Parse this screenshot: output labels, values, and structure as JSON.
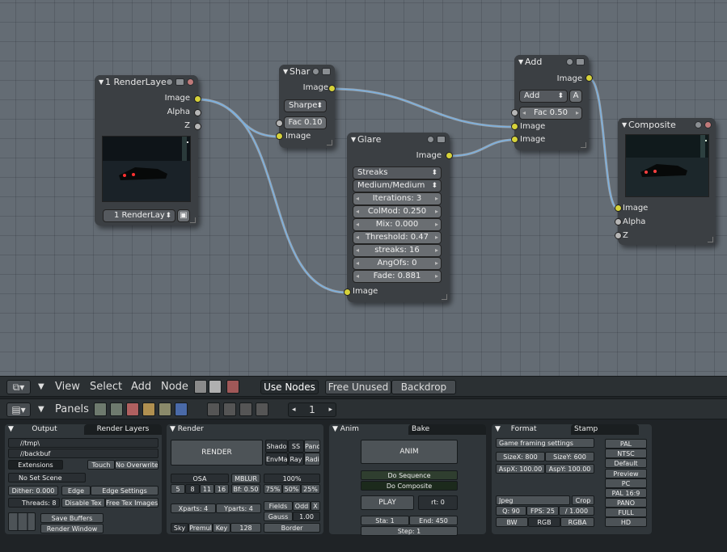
{
  "nodes": {
    "render_layers": {
      "title": "1 RenderLaye",
      "outputs": [
        "Image",
        "Alpha",
        "Z"
      ],
      "layer_select": "1 RenderLay"
    },
    "sharpen": {
      "title": "Shar",
      "output": "Image",
      "mode": "Sharpe",
      "fac": "Fac 0.10",
      "input": "Image"
    },
    "glare": {
      "title": "Glare",
      "output": "Image",
      "type": "Streaks",
      "quality": "Medium/Medium",
      "fields": [
        "Iterations: 3",
        "ColMod: 0.250",
        "Mix: 0.000",
        "Threshold: 0.47",
        "streaks: 16",
        "AngOfs: 0",
        "Fade: 0.881"
      ],
      "input": "Image"
    },
    "add": {
      "title": "Add",
      "output": "Image",
      "mode": "Add",
      "alpha_btn": "A",
      "fac": "Fac 0.50",
      "inputs": [
        "Image",
        "Image"
      ]
    },
    "composite": {
      "title": "Composite",
      "inputs": [
        "Image",
        "Alpha",
        "Z"
      ]
    }
  },
  "node_header": {
    "menus": [
      "View",
      "Select",
      "Add",
      "Node"
    ],
    "use_nodes": "Use Nodes",
    "free_unused": "Free Unused",
    "backdrop": "Backdrop"
  },
  "buttons_header": {
    "panels": "Panels",
    "frame": "1"
  },
  "output_panel": {
    "tab_active": "Output",
    "tab_other": "Render Layers",
    "path1": "//tmp\\",
    "path2": "//backbuf",
    "extensions": "Extensions",
    "touch": "Touch",
    "no_overwrite": "No Overwrite",
    "no_set_scene": "No Set Scene",
    "dither": "Dither: 0.000",
    "edge": "Edge",
    "edge_settings": "Edge Settings",
    "threads": "Threads: 8",
    "disable_tex": "Disable Tex",
    "free_tex_images": "Free Tex Images",
    "save_buffers": "Save Buffers",
    "render_window": "Render Window"
  },
  "render_panel": {
    "tab": "Render",
    "render_btn": "RENDER",
    "shadow": "Shado",
    "ss": "SS",
    "pano": "Pano",
    "envmap": "EnvMa",
    "ray": "Ray",
    "radio": "Radi",
    "osa": "OSA",
    "mblur": "MBLUR",
    "percent": "100%",
    "osa_values": [
      "5",
      "8",
      "11",
      "16"
    ],
    "bf": "Bf: 0.50",
    "sizes": [
      "75%",
      "50%",
      "25%"
    ],
    "xparts": "Xparts: 4",
    "yparts": "Yparts: 4",
    "fields": "Fields",
    "odd": "Odd",
    "x": "X",
    "gauss": "Gauss",
    "gauss_val": "1.00",
    "sky": "Sky",
    "premul": "Premul",
    "key": "Key",
    "bits": "128",
    "border": "Border"
  },
  "anim_panel": {
    "tab_active": "Anim",
    "tab_other": "Bake",
    "anim_btn": "ANIM",
    "do_sequence": "Do Sequence",
    "do_composite": "Do Composite",
    "play": "PLAY",
    "rt": "rt: 0",
    "sta": "Sta: 1",
    "end": "End: 450",
    "step": "Step: 1"
  },
  "format_panel": {
    "tab_active": "Format",
    "tab_other": "Stamp",
    "game_framing": "Game framing settings",
    "sizex": "SizeX: 800",
    "sizey": "SizeY: 600",
    "aspx": "AspX: 100.00",
    "aspy": "AspY: 100.00",
    "codec": "Jpeg",
    "crop": "Crop",
    "quality": "Q: 90",
    "fps": "FPS: 25",
    "fps_base": "/ 1.000",
    "bw": "BW",
    "rgb": "RGB",
    "rgba": "RGBA",
    "presets": [
      "PAL",
      "NTSC",
      "Default",
      "Preview",
      "PC",
      "PAL 16:9",
      "PANO",
      "FULL",
      "HD"
    ]
  },
  "colors": {
    "grid": "#646c74",
    "node": "#3b3f43",
    "socket_image": "#d6d23a",
    "socket_value": "#b6b6b6",
    "wire": "#7ab0e0"
  }
}
